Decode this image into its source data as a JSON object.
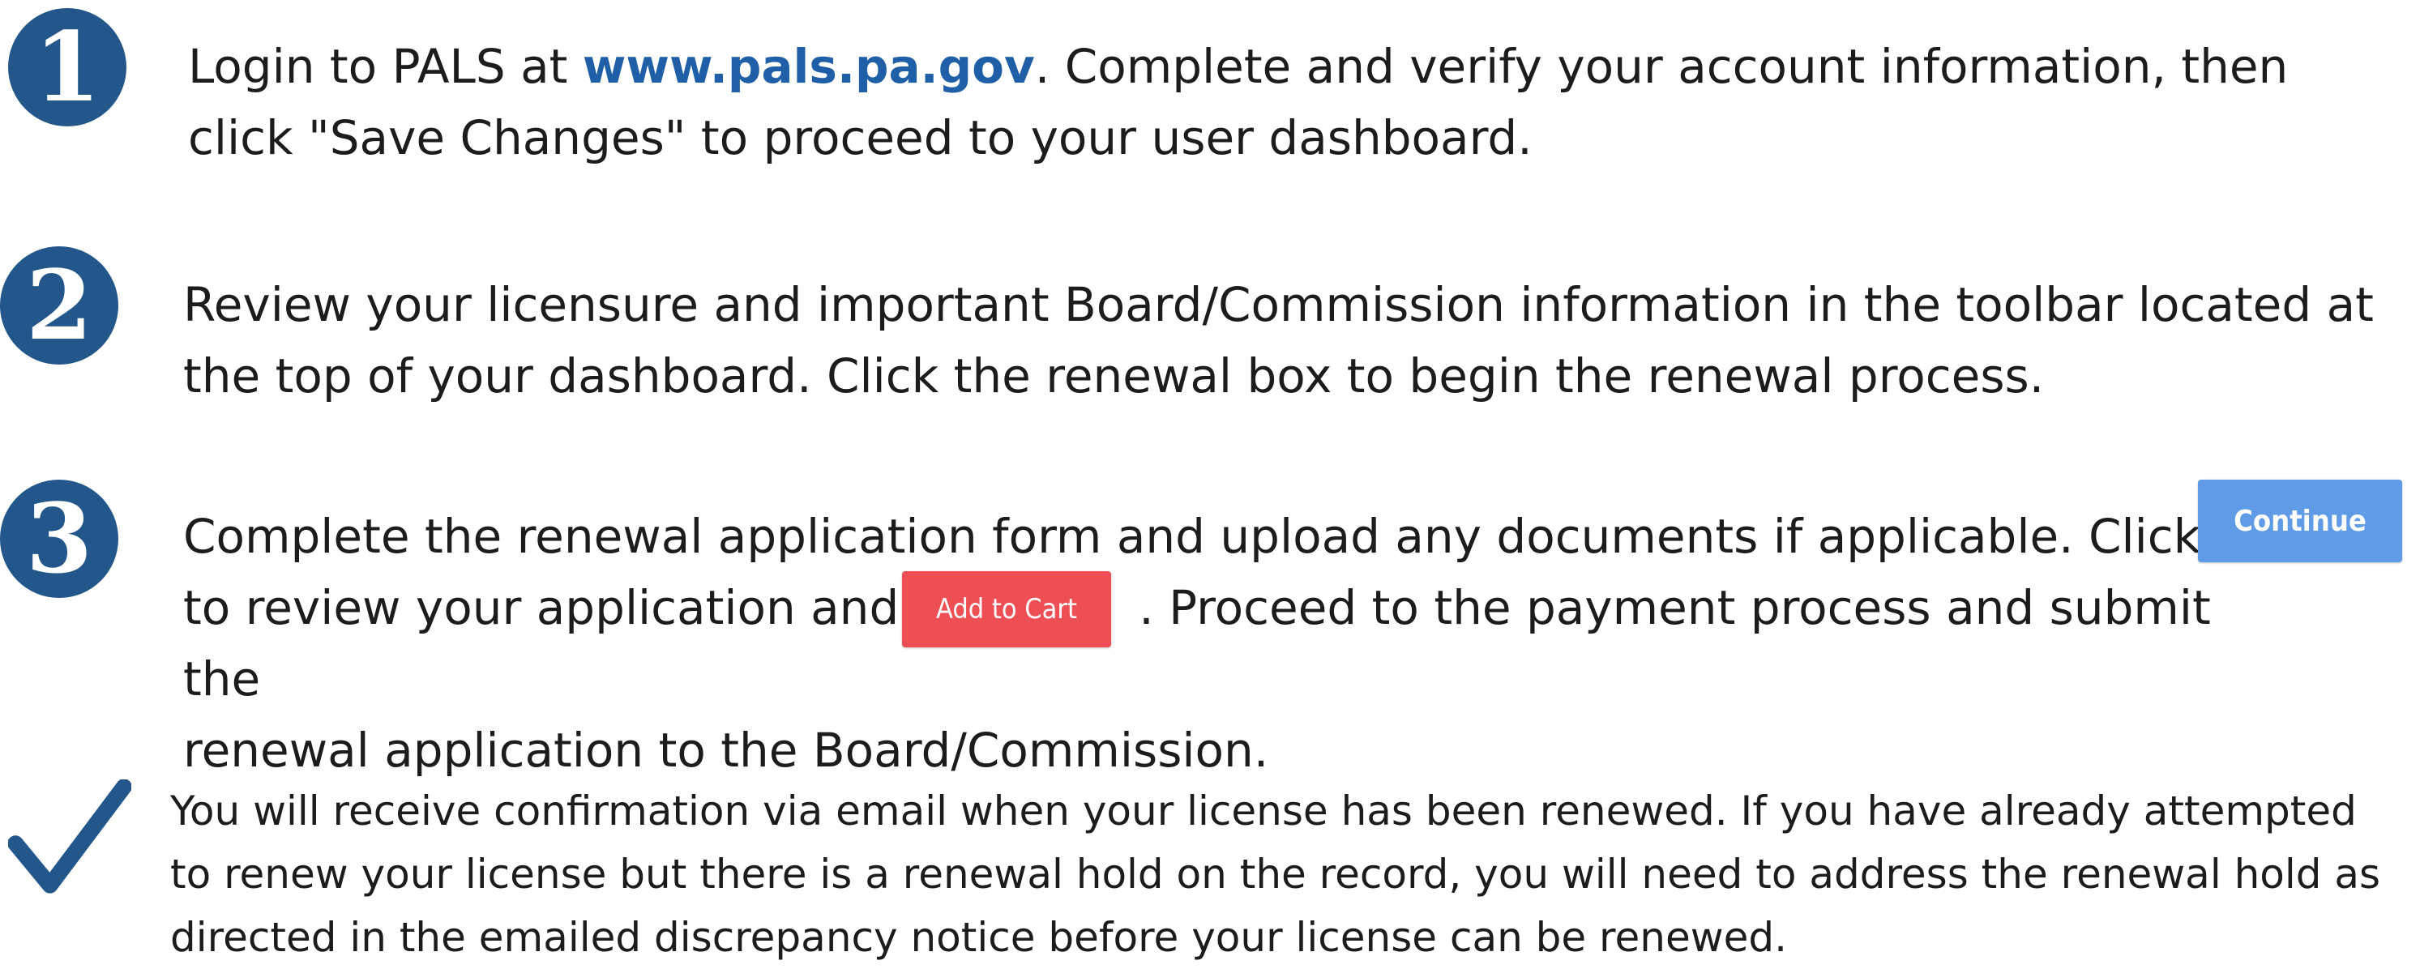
{
  "steps": [
    {
      "number": "1",
      "text_before_link": "Login to PALS at ",
      "link_text": "www.pals.pa.gov",
      "text_after_link": ". Complete and verify your account information, then click \"Save Changes\" to proceed to your user dashboard."
    },
    {
      "number": "2",
      "text": "Review your licensure and important Board/Commission information in the toolbar located at the top of your dashboard. Click the renewal box to begin the renewal process."
    },
    {
      "number": "3",
      "text_part1": "Complete the renewal application form and upload any documents if applicable. Click",
      "text_part2": "to review your application and",
      "text_part3": ". Proceed to the payment process and submit the",
      "text_part4": "renewal application to the Board/Commission.",
      "continue_label": "Continue",
      "add_to_cart_label": "Add to Cart"
    }
  ],
  "note": {
    "text": "You will receive confirmation via email when your license has been renewed.  If you have already attempted to renew your license but there is a renewal hold on the record, you will need to address the renewal hold as directed in the emailed discrepancy notice before your license can be renewed."
  },
  "colors": {
    "badge": "#23568a",
    "link": "#1f5fa8",
    "continue_button": "#5f9be6",
    "add_to_cart_button": "#ed4f54",
    "check": "#23568a"
  },
  "icons": {
    "check": "checkmark-icon"
  }
}
